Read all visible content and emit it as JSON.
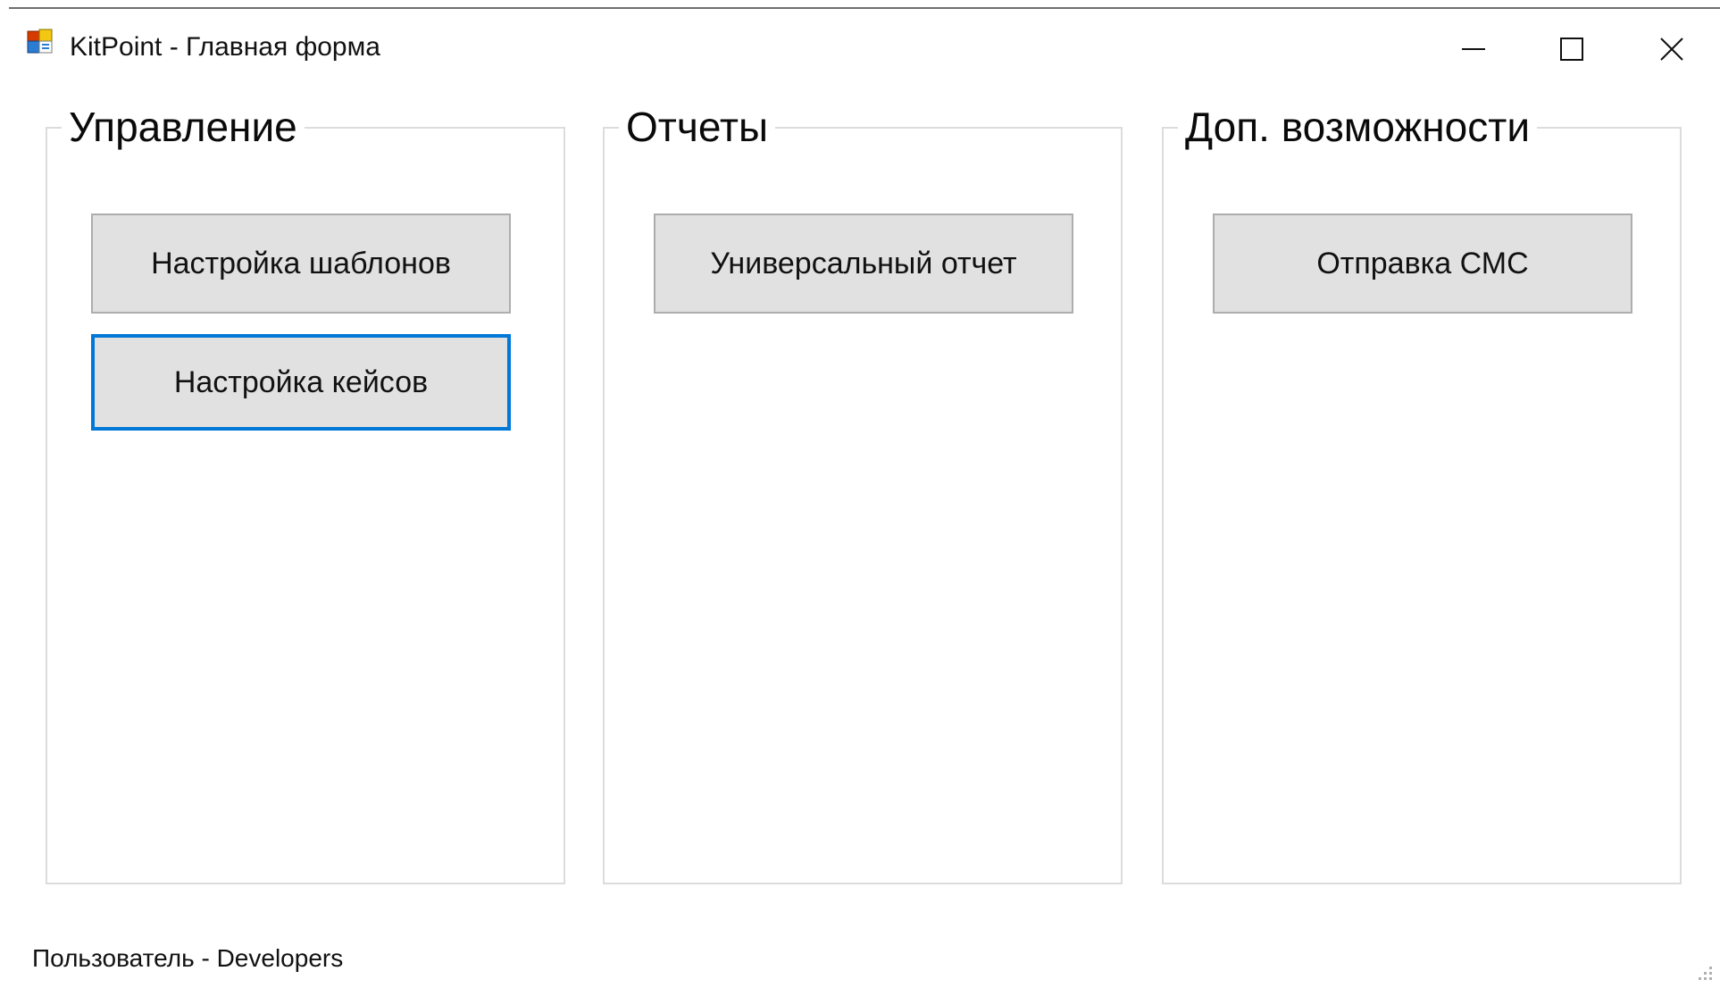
{
  "window": {
    "title": "KitPoint - Главная форма",
    "app_icon": "winforms-app-icon",
    "controls": {
      "minimize_icon": "minimize-icon",
      "maximize_icon": "maximize-icon",
      "close_icon": "close-icon"
    }
  },
  "groups": [
    {
      "title": "Управление",
      "buttons": [
        {
          "label": "Настройка шаблонов",
          "focused": false
        },
        {
          "label": "Настройка кейсов",
          "focused": true
        }
      ]
    },
    {
      "title": "Отчеты",
      "buttons": [
        {
          "label": "Универсальный отчет",
          "focused": false
        }
      ]
    },
    {
      "title": "Доп. возможности",
      "buttons": [
        {
          "label": "Отправка СМС",
          "focused": false
        }
      ]
    }
  ],
  "status": {
    "user_text": "Пользователь - Developers"
  },
  "colors": {
    "focus_border": "#0078d7",
    "button_face": "#e1e1e1",
    "button_border": "#adadad",
    "group_border": "#dcdcdc"
  }
}
